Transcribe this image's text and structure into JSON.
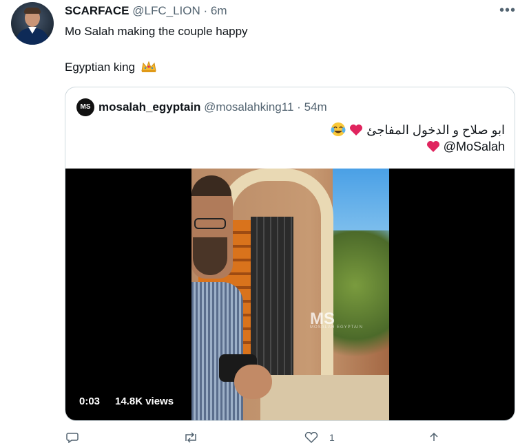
{
  "tweet": {
    "name": "SCARFACE",
    "handle": "@LFC_LION",
    "separator": "·",
    "time": "6m",
    "more": "•••",
    "line1": "Mo Salah making the couple happy",
    "line2": "Egyptian king",
    "crown_icon": "crown-emoji"
  },
  "quote": {
    "avatar_text": "MS",
    "name": "mosalah_egyptain",
    "handle": "@mosalahking11",
    "separator": "·",
    "time": "54m",
    "text_line1": "ابو صلاح و الدخول المفاجئ",
    "text_line2": "@MoSalah",
    "heart_color": "#e0245e",
    "video": {
      "watermark": "MS",
      "watermark_sub": "MOSALAH EGYPTAIN",
      "time": "0:03",
      "views": "14.8K views"
    }
  },
  "actions": {
    "like_count": "1"
  },
  "colors": {
    "text": "#0f1419",
    "muted": "#536471",
    "border": "#cfd9de"
  }
}
